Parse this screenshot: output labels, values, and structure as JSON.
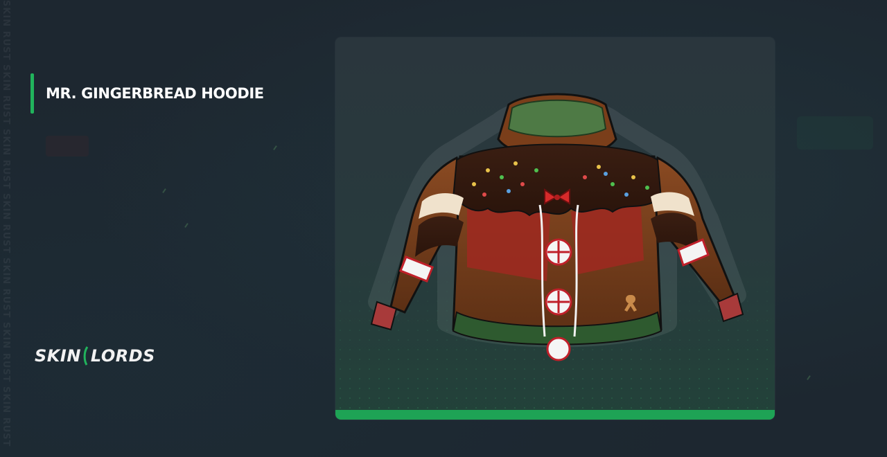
{
  "page": {
    "item_title": "MR. GINGERBREAD HOODIE",
    "watermark_text": "SKIN RUST SKIN RUST SKIN RUST SKIN RUST SKIN RUST SKIN RUST SKIN RUST",
    "logo": {
      "part1": "SKIN",
      "part2": "LORDS"
    }
  },
  "colors": {
    "accent_green": "#21b35c",
    "card_bar": "#1ea355",
    "background": "#1d2730"
  },
  "image": {
    "subject": "gingerbread-hoodie-icon"
  }
}
